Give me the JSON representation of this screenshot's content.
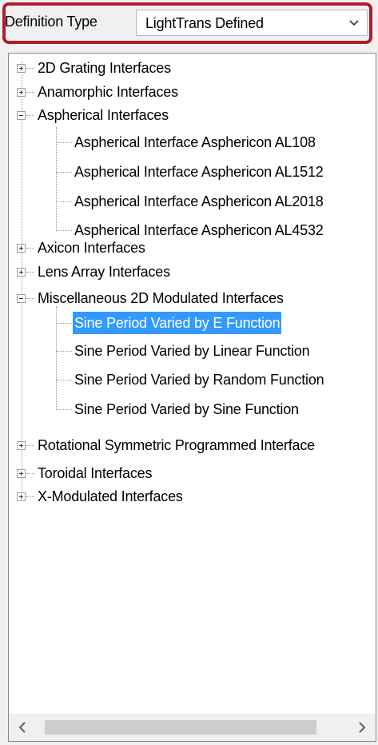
{
  "definition": {
    "label": "Definition Type",
    "selected_value": "LightTrans Defined"
  },
  "tree": {
    "items": [
      {
        "label": "2D Grating Interfaces",
        "expanded": false
      },
      {
        "label": "Anamorphic Interfaces",
        "expanded": false
      },
      {
        "label": "Aspherical Interfaces",
        "expanded": true,
        "children": [
          "Aspherical Interface Asphericon AL108",
          "Aspherical Interface Asphericon AL1512",
          "Aspherical Interface Asphericon AL2018",
          "Aspherical Interface Asphericon AL4532"
        ]
      },
      {
        "label": "Axicon Interfaces",
        "expanded": false
      },
      {
        "label": "Lens Array Interfaces",
        "expanded": false
      },
      {
        "label": "Miscellaneous 2D Modulated Interfaces",
        "expanded": true,
        "children": [
          "Sine Period Varied by E Function",
          "Sine Period Varied by Linear Function",
          "Sine Period Varied by Random Function",
          "Sine Period Varied by Sine Function"
        ]
      },
      {
        "label": "Rotational Symmetric Programmed Interface",
        "expanded": false
      },
      {
        "label": "Toroidal Interfaces",
        "expanded": false
      },
      {
        "label": "X-Modulated Interfaces",
        "expanded": false
      }
    ],
    "selected_item": "Sine Period Varied by E Function"
  },
  "colors": {
    "highlight_border": "#b01c2e",
    "selection_bg": "#3399ff"
  },
  "icons": {
    "dropdown": "chevron-down-icon",
    "scroll_left": "chevron-left-icon",
    "scroll_right": "chevron-right-icon",
    "expand": "plus-box-icon",
    "collapse": "minus-box-icon"
  }
}
